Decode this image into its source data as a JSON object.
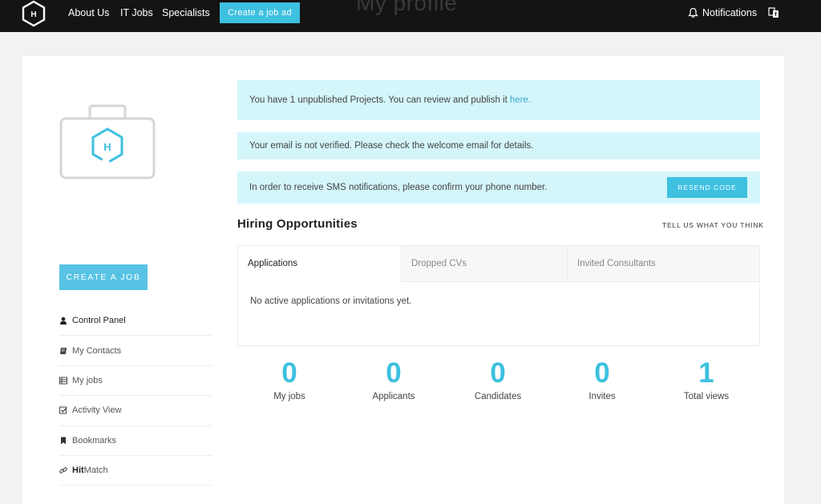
{
  "header": {
    "ghost_title": "My profile",
    "logo_letter": "H",
    "nav": [
      "About Us",
      "IT Jobs",
      "Specialists"
    ],
    "create_job_ad": "Create a job ad",
    "notifications": "Notifications"
  },
  "sidebar": {
    "logo_letter": "H",
    "create_job": "CREATE A JOB",
    "items": [
      {
        "label": "Control Panel",
        "icon": "user-icon"
      },
      {
        "label": "My Contacts",
        "icon": "address-book-icon"
      },
      {
        "label": "My jobs",
        "icon": "list-icon"
      },
      {
        "label": "Activity View",
        "icon": "checkbox-icon"
      },
      {
        "label": "Bookmarks",
        "icon": "bookmark-icon"
      },
      {
        "label_bold": "Hit",
        "label_rest": "Match",
        "icon": "link-icon"
      }
    ]
  },
  "alerts": {
    "unpublished": "You have 1 unpublished Projects. You can review and publish it",
    "unpublished_link": "here.",
    "email": "Your email is not verified. Please check the welcome email for details.",
    "sms": "In order to receive SMS notifications, please confirm your phone number.",
    "resend": "RESEND CODE"
  },
  "hiring": {
    "title": "Hiring Opportunities",
    "feedback": "TELL US WHAT YOU THINK",
    "tabs": [
      "Applications",
      "Dropped CVs",
      "Invited Consultants"
    ],
    "empty": "No active applications or invitations yet."
  },
  "stats": [
    {
      "value": "0",
      "label": "My jobs"
    },
    {
      "value": "0",
      "label": "Applicants"
    },
    {
      "value": "0",
      "label": "Candidates"
    },
    {
      "value": "0",
      "label": "Invites"
    },
    {
      "value": "1",
      "label": "Total views"
    }
  ],
  "colors": {
    "accent": "#3ec0e0",
    "topbar": "#141414",
    "alert_bg": "#d4f6fa"
  }
}
